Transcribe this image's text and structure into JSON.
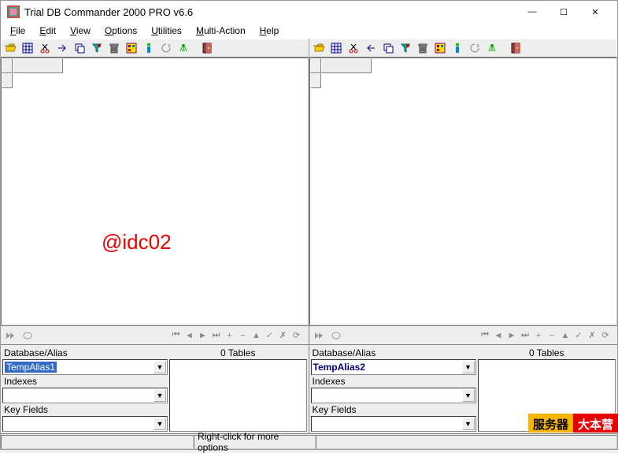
{
  "title": "Trial DB Commander 2000 PRO v6.6",
  "menu": [
    "File",
    "Edit",
    "View",
    "Options",
    "Utilities",
    "Multi-Action",
    "Help"
  ],
  "watermark": "@idc02",
  "statusbar": {
    "hint": "Right-click for more options"
  },
  "badge": {
    "left": "服务器",
    "right": "大本营"
  },
  "panes": [
    {
      "db_label": "Database/Alias",
      "db_value": "TempAlias1",
      "idx_label": "Indexes",
      "idx_value": "",
      "key_label": "Key Fields",
      "key_value": "",
      "tables_hdr": "0 Tables"
    },
    {
      "db_label": "Database/Alias",
      "db_value": "TempAlias2",
      "idx_label": "Indexes",
      "idx_value": "",
      "key_label": "Key Fields",
      "key_value": "",
      "tables_hdr": "0 Tables"
    }
  ]
}
